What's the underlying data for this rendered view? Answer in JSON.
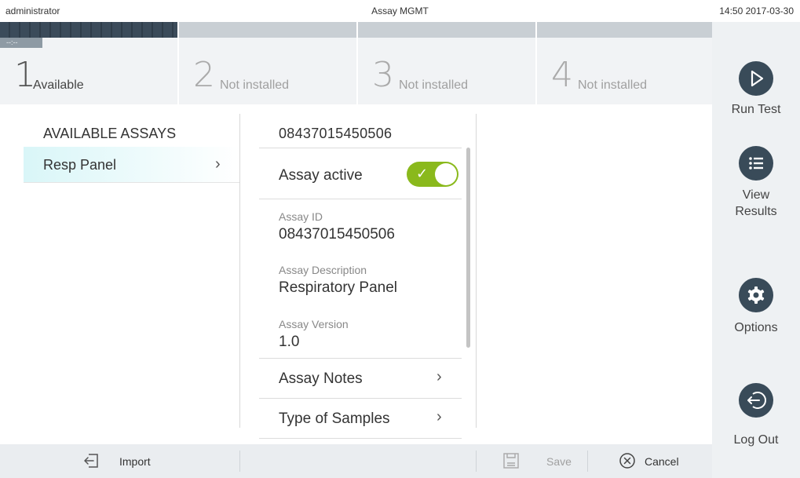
{
  "status_bar": {
    "user": "administrator",
    "title": "Assay MGMT",
    "datetime": "14:50 2017-03-30"
  },
  "modules": [
    {
      "number": "1",
      "label": "Available",
      "tag": "--:--"
    },
    {
      "number": "2",
      "label": "Not installed"
    },
    {
      "number": "3",
      "label": "Not installed"
    },
    {
      "number": "4",
      "label": "Not installed"
    }
  ],
  "sidebar": {
    "run_test": "Run Test",
    "view_results_line1": "View",
    "view_results_line2": "Results",
    "options": "Options",
    "log_out": "Log Out"
  },
  "assays": {
    "header": "AVAILABLE ASSAYS",
    "items": [
      {
        "label": "Resp Panel"
      }
    ]
  },
  "detail": {
    "header": "08437015450506",
    "active_label": "Assay active",
    "active": true,
    "fields": [
      {
        "label": "Assay ID",
        "value": "08437015450506"
      },
      {
        "label": "Assay Description",
        "value": "Respiratory Panel"
      },
      {
        "label": "Assay Version",
        "value": "1.0"
      }
    ],
    "nav": [
      {
        "label": "Assay Notes"
      },
      {
        "label": "Type of Samples"
      }
    ]
  },
  "toolbar": {
    "import_label": "Import",
    "save_label": "Save",
    "cancel_label": "Cancel"
  },
  "colors": {
    "accent_green": "#8ab91c",
    "dark_icon": "#394b59",
    "selected_row": "#d9f6f8"
  }
}
